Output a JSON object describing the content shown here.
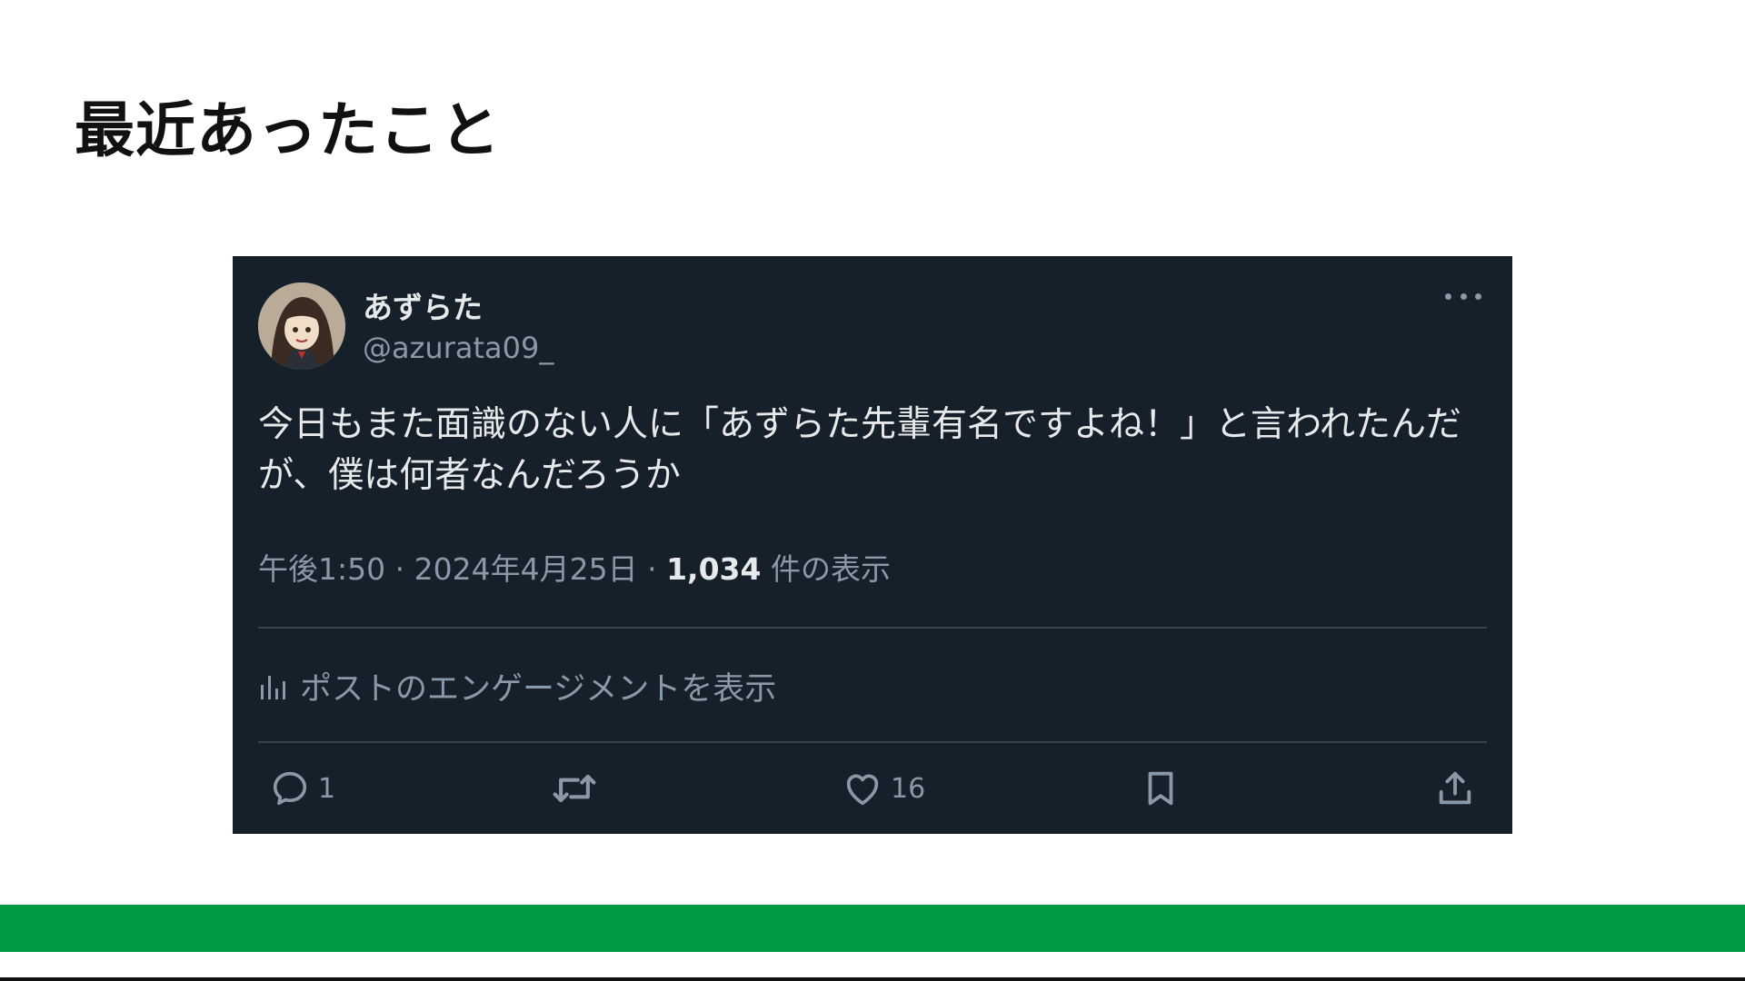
{
  "slide": {
    "title": "最近あったこと"
  },
  "tweet": {
    "author": {
      "display_name": "あずらた",
      "handle": "@azurata09_"
    },
    "text": "今日もまた面識のない人に「あずらた先輩有名ですよね！」と言われたんだが、僕は何者なんだろうか",
    "time": "午後1:50",
    "date": "2024年4月25日",
    "separator": "·",
    "views_count": "1,034",
    "views_label": "件の表示",
    "engagement_label": "ポストのエンゲージメントを表示",
    "actions": {
      "reply_count": "1",
      "like_count": "16"
    }
  },
  "colors": {
    "card_bg": "#15202b",
    "accent_green": "#009a44",
    "muted_text": "#8b98a5"
  },
  "icons": [
    "more-icon",
    "analytics-icon",
    "reply-icon",
    "retweet-icon",
    "like-icon",
    "bookmark-icon",
    "share-icon"
  ]
}
